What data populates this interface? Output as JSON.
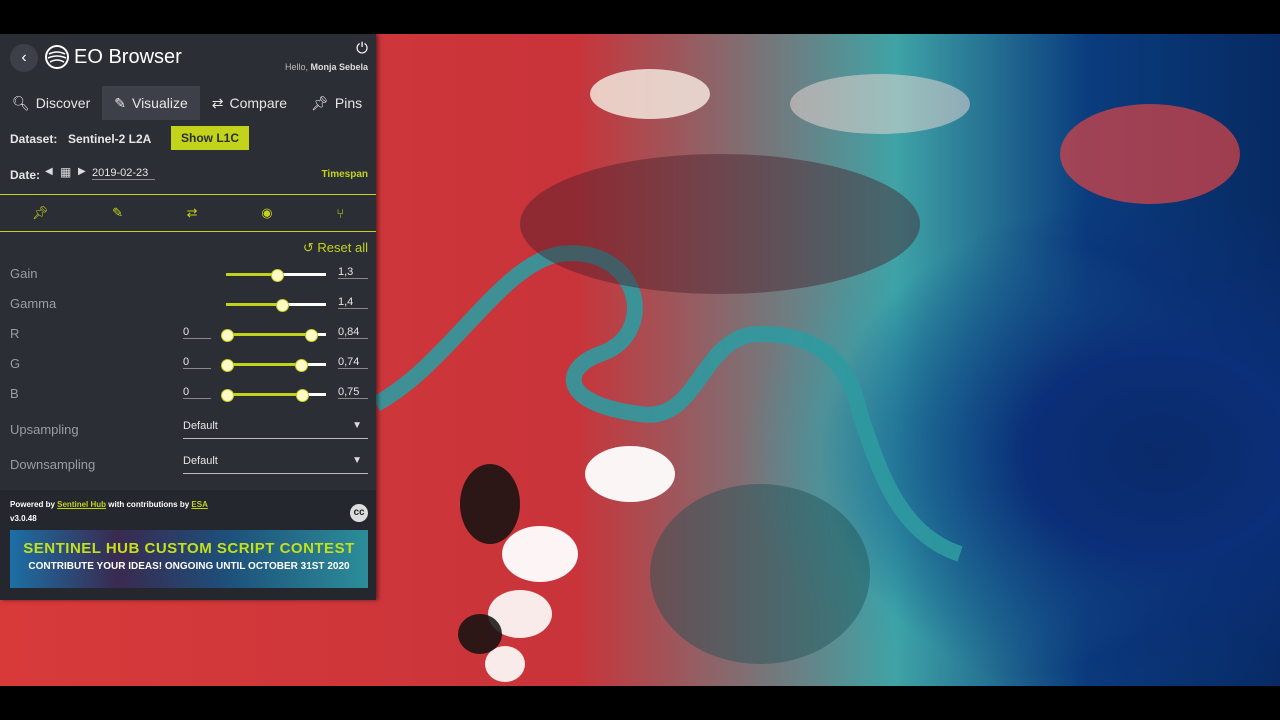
{
  "app": {
    "title": "EO Browser",
    "hello_prefix": "Hello,",
    "user": "Monja Sebela"
  },
  "tabs": [
    {
      "label": "Discover",
      "icon": "search-icon"
    },
    {
      "label": "Visualize",
      "icon": "brush-icon",
      "active": true
    },
    {
      "label": "Compare",
      "icon": "compare-icon"
    },
    {
      "label": "Pins",
      "icon": "pin-icon"
    }
  ],
  "dataset": {
    "label": "Dataset:",
    "value": "Sentinel-2 L2A",
    "button": "Show L1C"
  },
  "date": {
    "label": "Date:",
    "value": "2019-02-23",
    "timespan": "Timespan"
  },
  "reset_label": "Reset all",
  "sliders": [
    {
      "name": "Gain",
      "level": 0.5,
      "value": "1,3"
    },
    {
      "name": "Gamma",
      "level": 0.55,
      "value": "1,4"
    },
    {
      "name": "R",
      "min": "0",
      "level": 0.84,
      "value": "0,84"
    },
    {
      "name": "G",
      "min": "0",
      "level": 0.74,
      "value": "0,74"
    },
    {
      "name": "B",
      "min": "0",
      "level": 0.75,
      "value": "0,75"
    }
  ],
  "selects": [
    {
      "name": "Upsampling",
      "value": "Default"
    },
    {
      "name": "Downsampling",
      "value": "Default"
    }
  ],
  "footer": {
    "powered_a": "Powered by",
    "powered_link1": "Sentinel Hub",
    "powered_b": "with contributions by",
    "powered_link2": "ESA",
    "version": "v3.0.48",
    "banner_line1": "SENTINEL HUB CUSTOM SCRIPT CONTEST",
    "banner_line2": "CONTRIBUTE YOUR IDEAS! ONGOING UNTIL OCTOBER 31ST 2020"
  },
  "colors": {
    "accent": "#c3d21a",
    "panel": "#2b2e35"
  }
}
